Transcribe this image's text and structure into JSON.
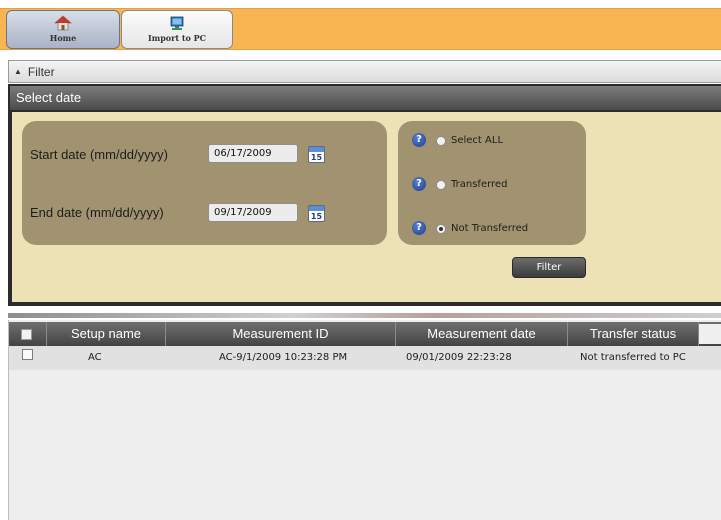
{
  "toolbar": {
    "home_label": "Home",
    "import_label": "Import to PC",
    "accent_color": "#f8b551"
  },
  "filter_strip": {
    "label": "Filter",
    "icon": "collapse-arrow-icon"
  },
  "select_date": {
    "title": "Select date",
    "start_label": "Start date (mm/dd/yyyy)",
    "start_value": "06/17/2009",
    "end_label": "End date (mm/dd/yyyy)",
    "end_value": "09/17/2009",
    "calendar_icon_text": "15",
    "options": [
      {
        "label": "Select ALL",
        "selected": false
      },
      {
        "label": "Transferred",
        "selected": false
      },
      {
        "label": "Not Transferred",
        "selected": true
      }
    ],
    "filter_button": "Filter"
  },
  "grid": {
    "columns": [
      "Setup name",
      "Measurement ID",
      "Measurement date",
      "Transfer status"
    ],
    "rows": [
      {
        "setup_name": "AC",
        "measurement_id": "AC-9/1/2009 10:23:28 PM",
        "measurement_date": "09/01/2009 22:23:28",
        "transfer_status": "Not transferred to PC"
      }
    ]
  }
}
